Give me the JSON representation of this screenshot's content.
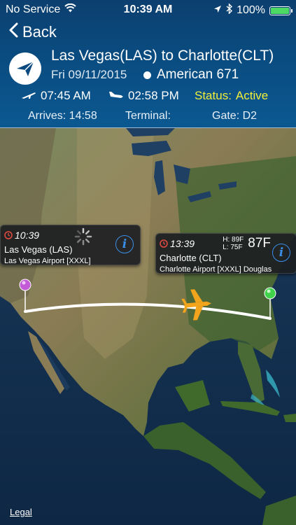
{
  "status_bar": {
    "carrier": "No Service",
    "time": "10:39 AM",
    "battery": "100%",
    "battery_level": 1.0,
    "icons": [
      "wifi-icon",
      "location-arrow-icon",
      "bluetooth-icon",
      "battery-icon"
    ]
  },
  "nav": {
    "back_label": "Back"
  },
  "flight": {
    "route_title": "Las Vegas(LAS) to Charlotte(CLT)",
    "date": "Fri 09/11/2015",
    "airline": "American 671",
    "departure_time": "07:45 AM",
    "arrival_time": "02:58 PM",
    "status_label": "Status:",
    "status_value": "Active",
    "arrives": "Arrives: 14:58",
    "terminal": "Terminal:",
    "gate": "Gate: D2"
  },
  "map": {
    "origin": {
      "time": "10:39",
      "name": "Las Vegas (LAS)",
      "airport": "Las Vegas Airport [XXXL]"
    },
    "destination": {
      "time": "13:39",
      "name": "Charlotte (CLT)",
      "airport": "Charlotte Airport [XXXL] Douglas",
      "high": "H: 89F",
      "low": "L: 75F",
      "temp": "87F"
    },
    "info_glyph": "i",
    "legal": "Legal"
  },
  "colors": {
    "header_top": "#0c3f6f",
    "header_bottom": "#0b5891",
    "status_active": "#f2ef3a",
    "origin_pin": "#c45bd6",
    "destination_pin": "#3fd24a",
    "plane": "#f2a51c",
    "info_blue": "#3a8ee8"
  }
}
